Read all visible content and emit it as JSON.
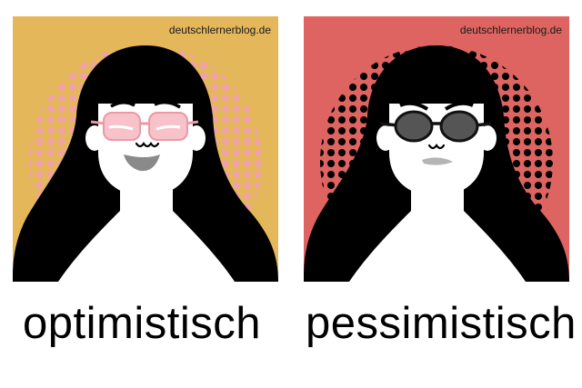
{
  "panels": [
    {
      "name": "left",
      "watermark": "deutschlernerblog.de",
      "caption": "optimistisch",
      "colors": {
        "background": "#e5b75b",
        "dots": "#f0a2a6",
        "glasses": "#f7c2ca",
        "glasses_frame": "#e99aa6",
        "mouth": "#8a8a8a"
      }
    },
    {
      "name": "right",
      "watermark": "deutschlernerblog.de",
      "caption": "pessimistisch",
      "colors": {
        "background": "#dd6461",
        "dots": "#000000",
        "glasses": "#555555",
        "glasses_frame": "#111111",
        "mouth": "#b5b5b5"
      }
    }
  ],
  "icons": {
    "portrait": "woman-portrait-icon",
    "glasses_left": "rose-tinted-glasses-icon",
    "glasses_right": "dark-sunglasses-icon"
  }
}
